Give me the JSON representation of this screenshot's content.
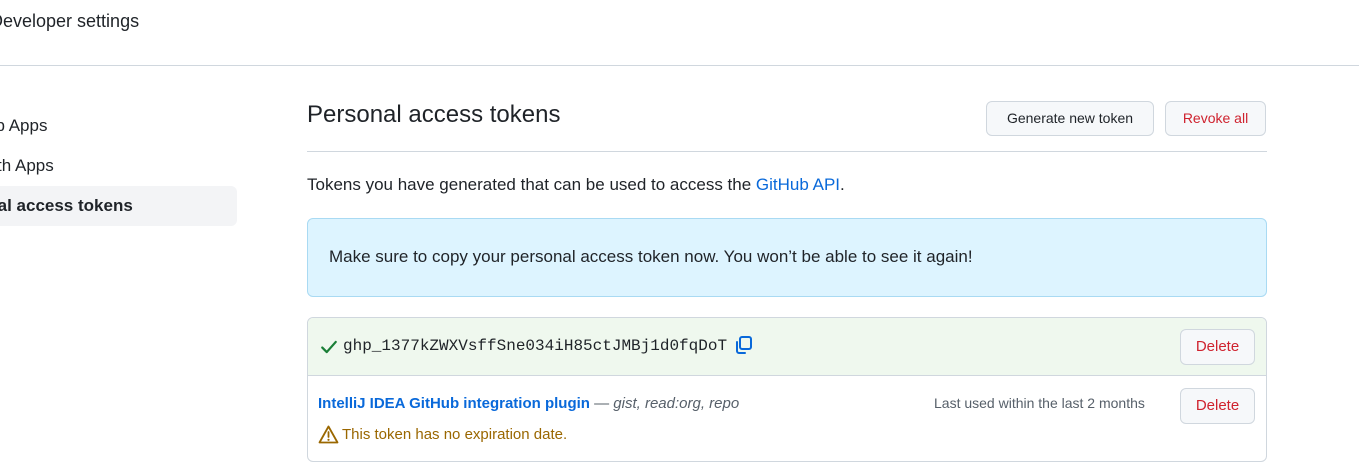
{
  "header": {
    "breadcrumb": "Developer settings"
  },
  "sidebar": {
    "items": [
      {
        "label": "GitHub Apps",
        "active": false
      },
      {
        "label": "OAuth Apps",
        "active": false
      },
      {
        "label": "Personal access tokens",
        "active": true
      }
    ]
  },
  "main": {
    "title": "Personal access tokens",
    "generate_label": "Generate new token",
    "revoke_label": "Revoke all",
    "description_prefix": "Tokens you have generated that can be used to access the ",
    "description_link": "GitHub API",
    "description_suffix": ".",
    "flash_message": "Make sure to copy your personal access token now. You won’t be able to see it again!"
  },
  "tokens": {
    "new_token_value": "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",
    "delete_label": "Delete",
    "item": {
      "name": "IntelliJ IDEA GitHub integration plugin",
      "separator": " — ",
      "scopes": "gist, read:org, repo",
      "last_used": "Last used within the last 2 months",
      "warning": "This token has no expiration date."
    }
  },
  "colors": {
    "accent": "#0969da",
    "danger": "#cf222e",
    "success": "#1a7f37",
    "flash_bg": "#ddf4ff",
    "warning": "#9a6700"
  },
  "icons": [
    "check-icon",
    "copy-icon",
    "alert-icon"
  ]
}
